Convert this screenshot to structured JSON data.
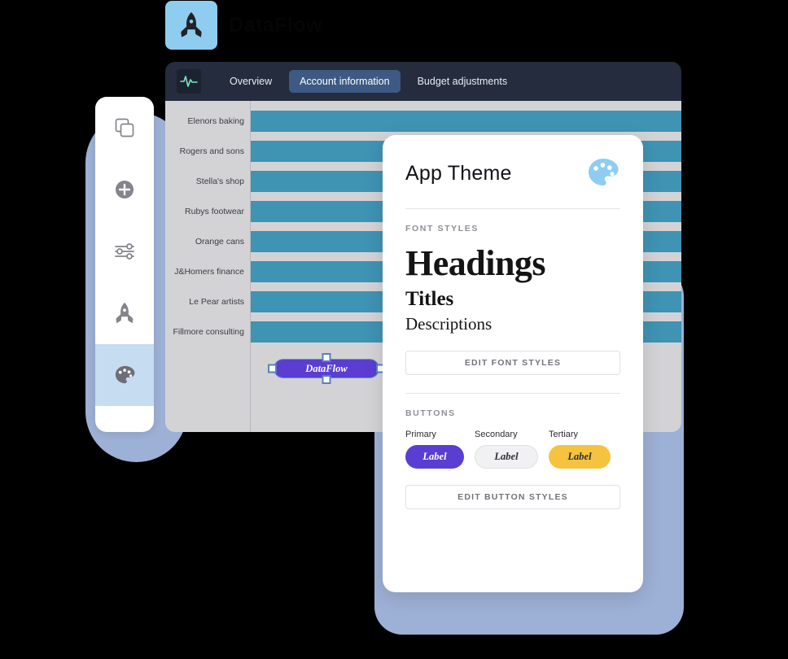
{
  "brand": {
    "word": "DataFlow",
    "icon": "rocket-icon",
    "tile_color": "#8ecdef"
  },
  "app": {
    "nav": {
      "logo_icon": "pulse-wave-icon",
      "tabs": [
        {
          "label": "Overview",
          "active": false
        },
        {
          "label": "Account information",
          "active": true
        },
        {
          "label": "Budget adjustments",
          "active": false
        }
      ],
      "active_tab_color": "#3c5a84",
      "bar_color": "#242c3d"
    },
    "canvas_node": {
      "label": "DataFlow",
      "color": "#5a3ed2",
      "selected": true,
      "handle_count": 4
    }
  },
  "sidebar": {
    "items": [
      {
        "icon": "copy-layers-icon",
        "active": false
      },
      {
        "icon": "plus-circle-icon",
        "active": false
      },
      {
        "icon": "sliders-icon",
        "active": false
      },
      {
        "icon": "rocket-icon",
        "active": false
      },
      {
        "icon": "palette-icon",
        "active": true
      }
    ],
    "active_color": "#c6dcf1"
  },
  "chart_data": {
    "type": "bar",
    "orientation": "horizontal",
    "title": "",
    "xlabel": "",
    "ylabel": "",
    "categories": [
      "Elenors baking",
      "Rogers and sons",
      "Stella's shop",
      "Rubys footwear",
      "Orange cans",
      "J&Homers finance",
      "Le Pear artists",
      "Fillmore consulting"
    ],
    "values": [
      100,
      100,
      100,
      100,
      100,
      100,
      100,
      100
    ],
    "xlim": [
      0,
      100
    ],
    "grid": false,
    "legend": null,
    "bar_color": "#3f93b3",
    "plot_background": "#d3d3d6"
  },
  "theme_panel": {
    "title": "App Theme",
    "icon": "palette-icon",
    "icon_color": "#8ecdef",
    "font_section": {
      "label": "FONT STYLES",
      "heading_sample": "Headings",
      "title_sample": "Titles",
      "description_sample": "Descriptions",
      "edit_button": "EDIT FONT STYLES"
    },
    "buttons_section": {
      "label": "BUTTONS",
      "variants": [
        {
          "name": "Primary",
          "label": "Label",
          "color": "#5a3ed2"
        },
        {
          "name": "Secondary",
          "label": "Label",
          "color": "#f1f1f4"
        },
        {
          "name": "Tertiary",
          "label": "Label",
          "color": "#f5c33f"
        }
      ],
      "edit_button": "EDIT BUTTON STYLES"
    }
  }
}
